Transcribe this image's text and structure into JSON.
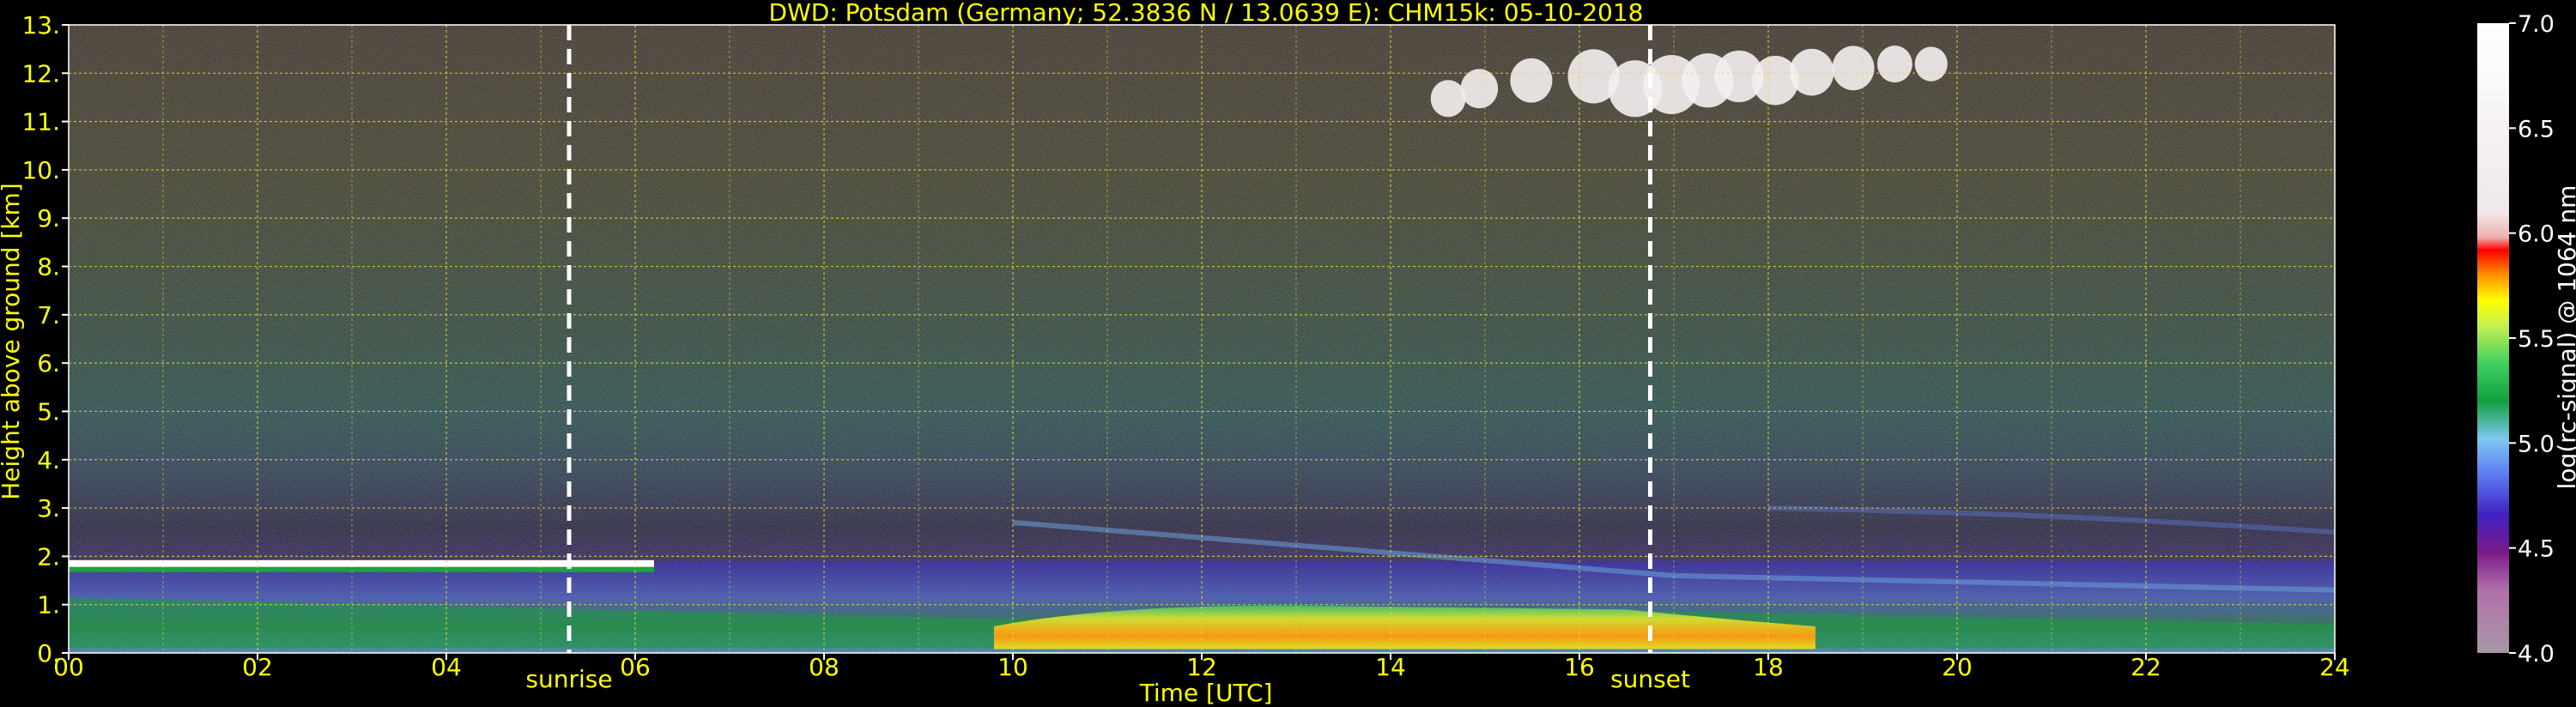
{
  "chart_data": {
    "type": "heatmap",
    "title": "DWD: Potsdam (Germany; 52.3836 N / 13.0639 E):    CHM15k: 05-10-2018",
    "xlabel": "Time [UTC]",
    "ylabel": "Height above ground [km]",
    "xlim": [
      0,
      24
    ],
    "ylim": [
      0,
      13
    ],
    "x_ticks": [
      "00",
      "02",
      "04",
      "06",
      "08",
      "10",
      "12",
      "14",
      "16",
      "18",
      "20",
      "22",
      "24"
    ],
    "y_ticks": [
      "0.",
      "1.",
      "2.",
      "3.",
      "4.",
      "5.",
      "6.",
      "7.",
      "8.",
      "9.",
      "10.",
      "11.",
      "12.",
      "13."
    ],
    "grid": true,
    "colorbar": {
      "label": "log(rc-signal) @ 1064 nm",
      "range": [
        4.0,
        7.0
      ],
      "ticks": [
        "4.0",
        "4.5",
        "5.0",
        "5.5",
        "6.0",
        "6.5",
        "7.0"
      ]
    },
    "annotations": [
      {
        "label": "sunrise",
        "x": 5.3
      },
      {
        "label": "sunset",
        "x": 16.75
      }
    ],
    "features": [
      {
        "name": "boundary layer cloud top",
        "x": [
          0,
          6.2
        ],
        "height_km": 1.85
      },
      {
        "name": "strong aerosol layer",
        "x": [
          10,
          16.5
        ],
        "height_km": [
          0.1,
          1.0
        ]
      },
      {
        "name": "cirrus cloud",
        "x": [
          14.5,
          20
        ],
        "height_km": [
          11.0,
          12.7
        ]
      }
    ]
  }
}
